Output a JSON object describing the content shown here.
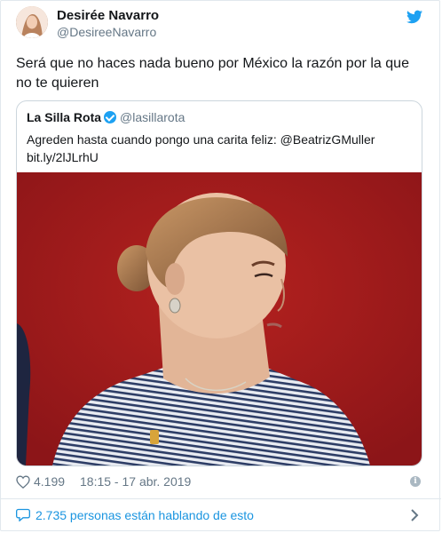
{
  "author": {
    "name": "Desirée Navarro",
    "handle": "@DesireeNavarro"
  },
  "tweet": {
    "text": "Será que no haces nada bueno por México la razón por la que no te quieren"
  },
  "quoted": {
    "name": "La Silla Rota",
    "handle": "@lasillarota",
    "text_line1": "Agreden hasta cuando pongo una carita feliz: @BeatrizGMuller",
    "text_line2": "bit.ly/2lJLrhU"
  },
  "meta": {
    "likes": "4.199",
    "timestamp": "18:15 - 17 abr. 2019",
    "info_icon": "i"
  },
  "conversation": {
    "label": "2.735 personas están hablando de esto"
  },
  "colors": {
    "brand_blue": "#1da1f2",
    "link_blue": "#1b95e0",
    "muted": "#657786",
    "photo_background": "#a5191d"
  },
  "icons": [
    "twitter-bird-icon",
    "verified-badge-icon",
    "heart-icon",
    "info-icon",
    "speech-bubble-icon",
    "chevron-right-icon"
  ]
}
